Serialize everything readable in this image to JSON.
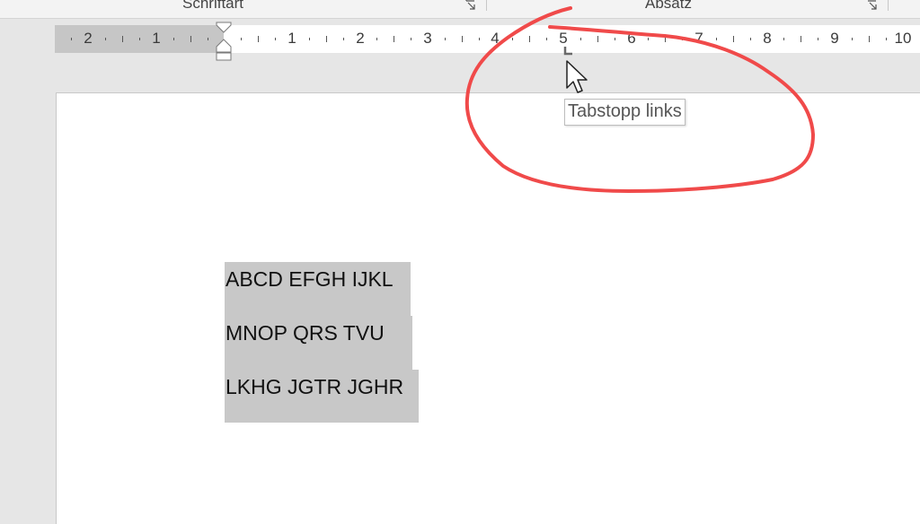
{
  "ribbon": {
    "groups": [
      {
        "label": "Schriftart"
      },
      {
        "label": "Absatz"
      }
    ]
  },
  "ruler": {
    "numbers": [
      "2",
      "1",
      "1",
      "2",
      "3",
      "4",
      "5",
      "6",
      "7",
      "8",
      "9",
      "10"
    ]
  },
  "tooltip": {
    "text": "Tabstopp links"
  },
  "document": {
    "lines": [
      "ABCD EFGH IJKL",
      "MNOP QRS TVU",
      "LKHG JGTR JGHR"
    ]
  },
  "colors": {
    "annotation": "#f04a4a",
    "selection": "#c8c8c8",
    "ruler_margin": "#c6c6c6"
  },
  "icons": {
    "launcher": "dialog-launcher-icon",
    "indent": "indent-marker-icon",
    "tab": "left-tab-stop-icon",
    "cursor": "mouse-pointer-icon"
  }
}
